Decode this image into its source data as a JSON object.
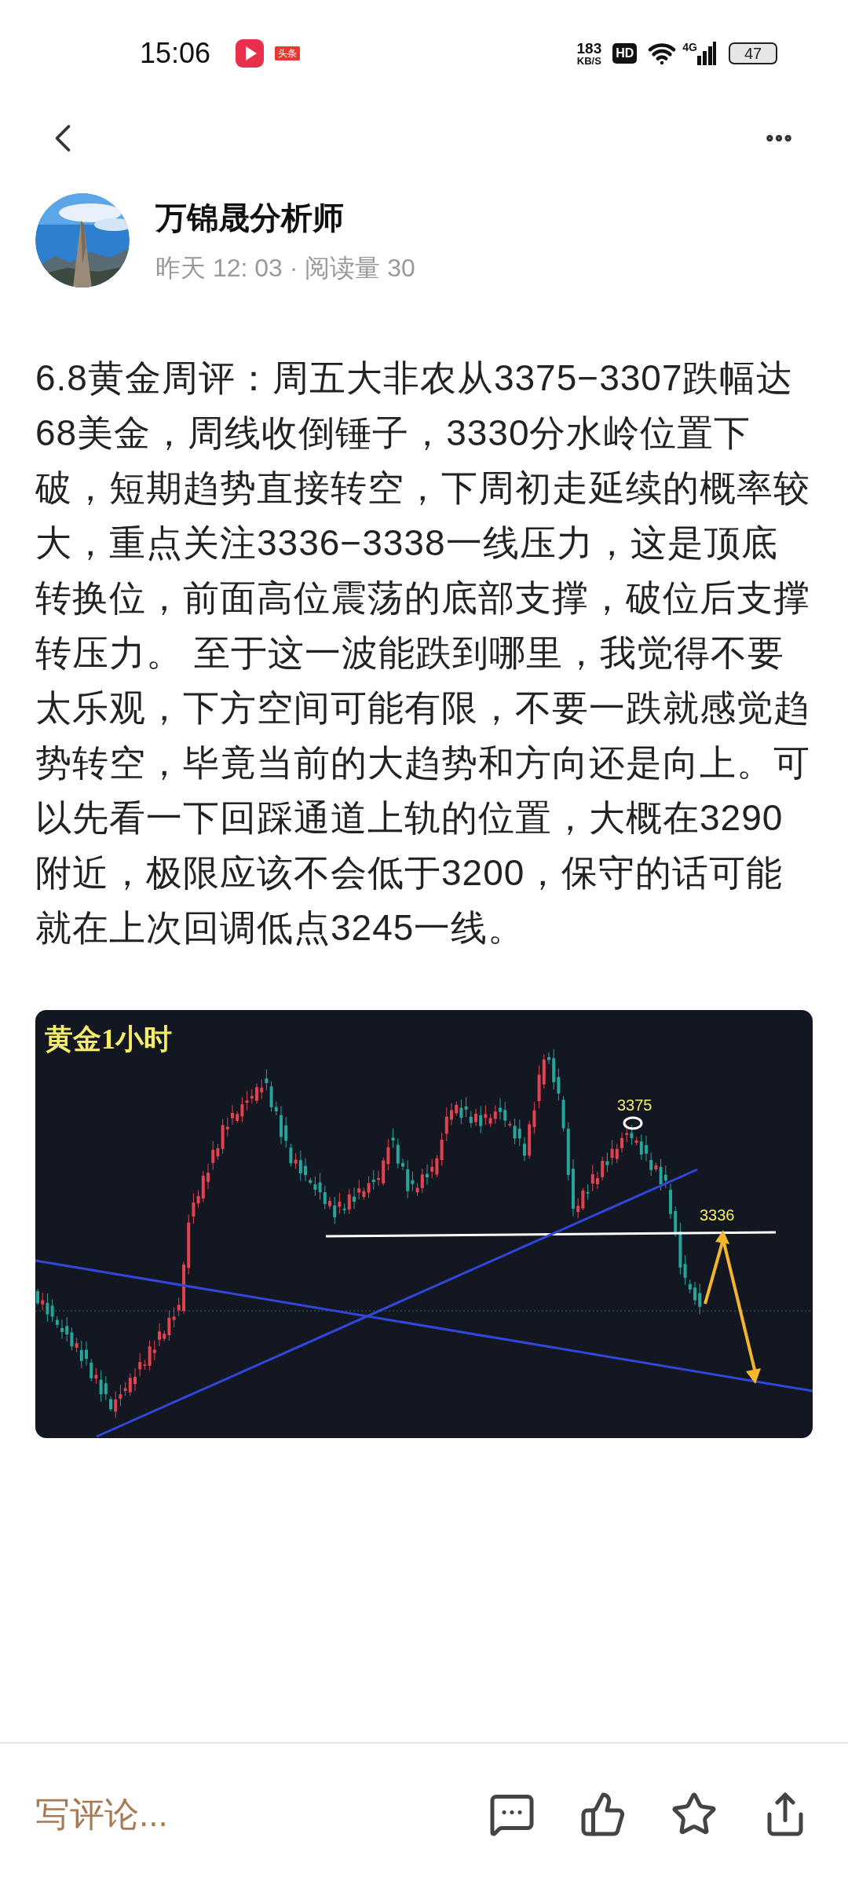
{
  "status_bar": {
    "time": "15:06",
    "app_badge": "头条",
    "net_speed": [
      "183",
      "KB/S"
    ],
    "hd": "HD",
    "network": "4G",
    "battery": "47"
  },
  "author": {
    "name": "万锦晟分析师",
    "meta": "昨天 12: 03 · 阅读量 30"
  },
  "article": {
    "body": "6.8黄金周评：周五大非农从3375−3307跌幅达68美金，周线收倒锤子，3330分水岭位置下破，短期趋势直接转空，下周初走延续的概率较大，重点关注3336−3338一线压力，这是顶底转换位，前面高位震荡的底部支撑，破位后支撑转压力。 至于这一波能跌到哪里，我觉得不要太乐观，下方空间可能有限，不要一跌就感觉趋势转空，毕竟当前的大趋势和方向还是向上。可以先看一下回踩通道上轨的位置，大概在3290附近，极限应该不会低于3200，保守的话可能就在上次回调低点3245一线。"
  },
  "chart_image": {
    "title": "黄金1小时",
    "labels": [
      {
        "kind": "peak",
        "text": "3375"
      },
      {
        "kind": "resistance",
        "text": "3336"
      }
    ]
  },
  "bottom_bar": {
    "comment_placeholder": "写评论..."
  }
}
